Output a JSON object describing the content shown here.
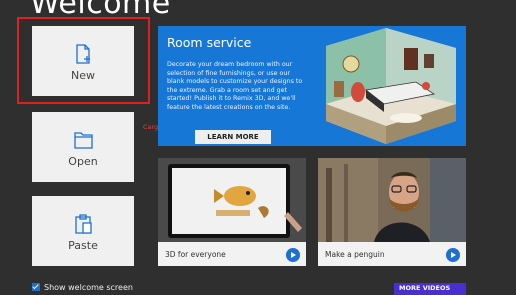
{
  "page": {
    "title": "Welcome"
  },
  "tiles": {
    "new_label": "New",
    "open_label": "Open",
    "paste_label": "Paste"
  },
  "annotation": "Cargar nuevo diseño",
  "hero": {
    "title": "Room service",
    "body": "Decorate your dream bedroom with our selection of fine furnishings, or use our blank models to customize your designs to the extreme. Grab a room set and get started! Publish it to Remix 3D, and we'll feature the latest creations on the site.",
    "button_label": "LEARN MORE"
  },
  "videos": [
    {
      "label": "3D for everyone"
    },
    {
      "label": "Make a penguin"
    }
  ],
  "footer": {
    "show_welcome_label": "Show welcome screen",
    "more_videos_label": "MORE VIDEOS"
  },
  "colors": {
    "background": "#2f2f2f",
    "tile": "#f0f0f0",
    "hero": "#1777d7",
    "accent": "#1e6fd0",
    "highlight": "#e02020"
  }
}
